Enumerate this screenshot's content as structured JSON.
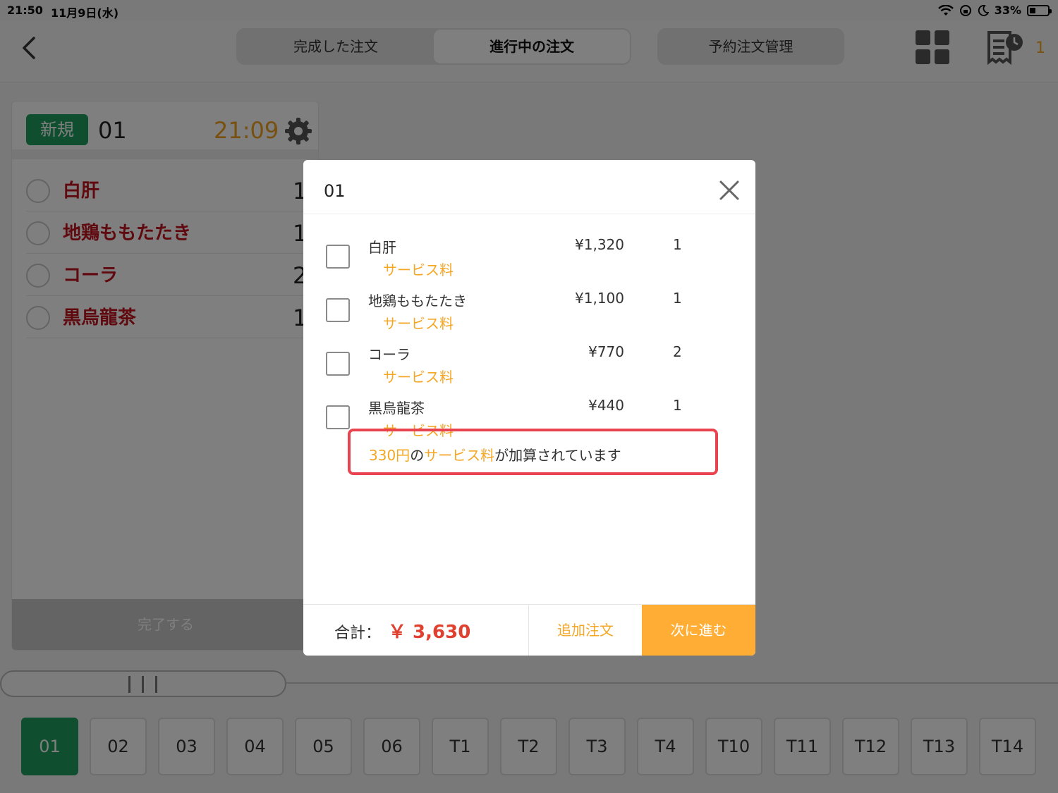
{
  "status_bar": {
    "time": "21:50",
    "date": "11月9日(水)",
    "battery": "33%"
  },
  "header": {
    "tabs": [
      "完成した注文",
      "進行中の注文"
    ],
    "active_tab": "進行中の注文",
    "reservation_button": "予約注文管理",
    "pending_count": "1"
  },
  "order_card": {
    "status_badge": "新規",
    "table": "01",
    "time": "21:09",
    "items": [
      {
        "name": "白肝",
        "qty": "1"
      },
      {
        "name": "地鶏ももたたき",
        "qty": "1"
      },
      {
        "name": "コーラ",
        "qty": "2"
      },
      {
        "name": "黒烏龍茶",
        "qty": "1"
      }
    ],
    "complete_button": "完了する"
  },
  "tables": [
    "01",
    "02",
    "03",
    "04",
    "05",
    "06",
    "T1",
    "T2",
    "T3",
    "T4",
    "T10",
    "T11",
    "T12",
    "T13",
    "T14"
  ],
  "selected_table": "01",
  "modal": {
    "title": "01",
    "items": [
      {
        "name": "白肝",
        "service": "サービス料",
        "price": "¥1,320",
        "qty": "1"
      },
      {
        "name": "地鶏ももたたき",
        "service": "サービス料",
        "price": "¥1,100",
        "qty": "1"
      },
      {
        "name": "コーラ",
        "service": "サービス料",
        "price": "¥770",
        "qty": "2"
      },
      {
        "name": "黒烏龍茶",
        "service": "サービス料",
        "price": "¥440",
        "qty": "1"
      }
    ],
    "notice": {
      "amount": "330円",
      "mid": "の",
      "service": "サービス料",
      "tail": "が加算されています"
    },
    "total_label": "合計：",
    "total_value": "￥ 3,630",
    "add_order_button": "追加注文",
    "next_button": "次に進む"
  },
  "colors": {
    "green": "#1f9d5c",
    "orange": "#f5a623",
    "red_text": "#c0141f",
    "total_red": "#e0402f",
    "highlight_border": "#e9434f"
  }
}
